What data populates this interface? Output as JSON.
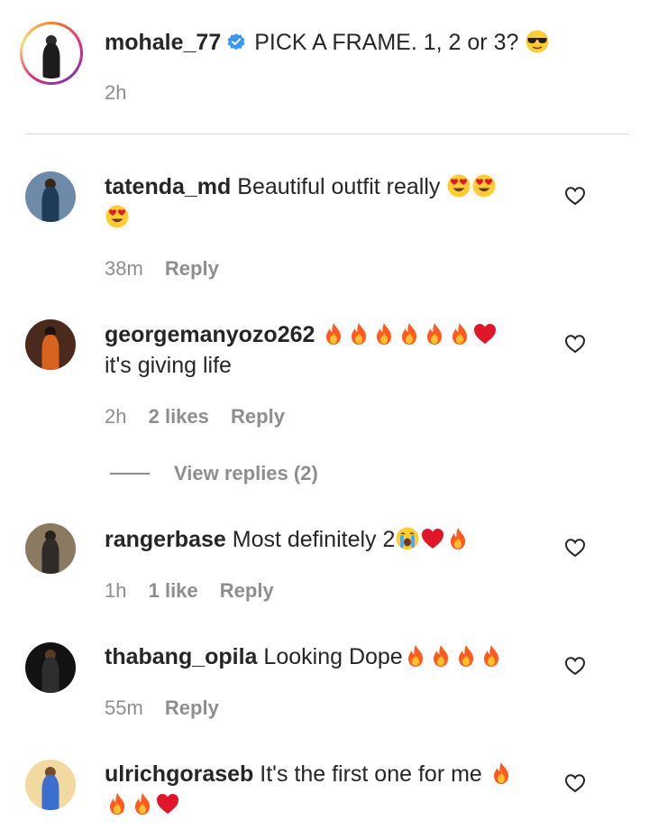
{
  "post": {
    "username": "mohale_77",
    "caption": "PICK A FRAME. 1, 2 or 3?",
    "caption_emoji": "sunglasses-emoji",
    "time": "2h"
  },
  "comments": [
    {
      "username": "tatenda_md",
      "text": "Beautiful outfit really",
      "emojis": [
        "heart-eyes",
        "heart-eyes",
        "heart-eyes"
      ],
      "time": "38m",
      "likes": "",
      "reply_label": "Reply"
    },
    {
      "username": "georgemanyozo262",
      "text": "it's giving life",
      "emojis": [
        "fire",
        "fire",
        "fire",
        "fire",
        "fire",
        "fire",
        "red-heart"
      ],
      "time": "2h",
      "likes": "2 likes",
      "reply_label": "Reply",
      "view_replies": "View replies (2)"
    },
    {
      "username": "rangerbase",
      "text": "Most definitely 2",
      "emojis": [
        "crying",
        "red-heart",
        "fire"
      ],
      "time": "1h",
      "likes": "1 like",
      "reply_label": "Reply"
    },
    {
      "username": "thabang_opila",
      "text": "Looking Dope",
      "emojis": [
        "fire",
        "fire",
        "fire",
        "fire"
      ],
      "time": "55m",
      "likes": "",
      "reply_label": "Reply"
    },
    {
      "username": "ulrichgoraseb",
      "text": "It's the first one for me",
      "emojis": [
        "fire",
        "fire",
        "fire",
        "red-heart"
      ],
      "time": "",
      "likes": "",
      "reply_label": ""
    }
  ],
  "colors": {
    "text": "#262626",
    "meta": "#8e8e8e",
    "divider": "#dbdbdb",
    "verified": "#3897f0",
    "fire": "#ff5a1f",
    "heart_red": "#e0162b"
  }
}
